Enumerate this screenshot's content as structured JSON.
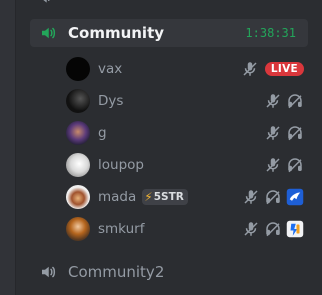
{
  "channels": [
    {
      "name": "Community",
      "timer": "1:38:31",
      "icon": "speaker-icon",
      "active": true
    },
    {
      "name": "Community2",
      "icon": "speaker-icon",
      "active": false
    }
  ],
  "users": [
    {
      "name": "vax",
      "live_badge": "LIVE",
      "icons": [
        "mic-muted-icon"
      ]
    },
    {
      "name": "Dys",
      "icons": [
        "mic-muted-icon",
        "headphones-deafened-icon"
      ]
    },
    {
      "name": "g",
      "icons": [
        "mic-muted-icon",
        "headphones-deafened-icon"
      ]
    },
    {
      "name": "loupop",
      "icons": [
        "mic-muted-icon",
        "headphones-deafened-icon"
      ]
    },
    {
      "name": "mada",
      "tag": "5STR",
      "icons": [
        "mic-muted-icon",
        "headphones-deafened-icon",
        "rocket-league-icon"
      ]
    },
    {
      "name": "smkurf",
      "icons": [
        "mic-muted-icon",
        "headphones-deafened-icon",
        "game-activity-icon"
      ]
    }
  ],
  "colors": {
    "background": "#2b2d31",
    "timer": "#23a55a",
    "live": "#da373c",
    "speaker": "#23a55a",
    "muted_text": "#949ba4"
  }
}
